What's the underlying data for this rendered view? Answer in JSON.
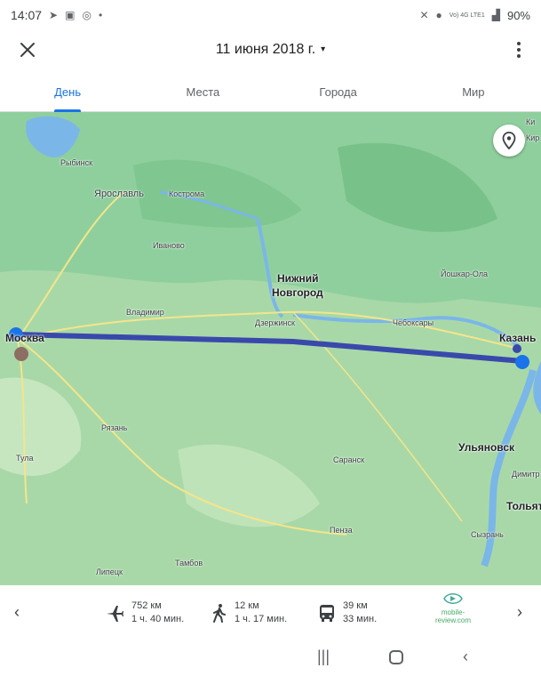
{
  "status": {
    "time": "14:07",
    "network": "Vo) 4G LTE1",
    "battery": "90%"
  },
  "appbar": {
    "date": "11 июня 2018 г.",
    "caret": "▾",
    "close_icon": "close-icon",
    "more_icon": "more-vert-icon"
  },
  "tabs": [
    {
      "label": "День",
      "active": true
    },
    {
      "label": "Места",
      "active": false
    },
    {
      "label": "Города",
      "active": false
    },
    {
      "label": "Мир",
      "active": false
    }
  ],
  "map": {
    "route_color": "#3949ab",
    "cities": {
      "rybinsk": "Рыбинск",
      "yaroslavl": "Ярославль",
      "kostroma": "Кострома",
      "ivanovo": "Иваново",
      "nizhny1": "Нижний",
      "nizhny2": "Новгород",
      "vladimir": "Владимир",
      "dzerzhinsk": "Дзержинск",
      "cheboksary": "Чебоксары",
      "yoshkar": "Йошкар-Ола",
      "kazan": "Казань",
      "moscow": "Москва",
      "ryazan": "Рязань",
      "tula": "Тула",
      "saransk": "Саранск",
      "ulyanovsk": "Ульяновск",
      "dimitrovgrad": "Димитр",
      "tolyatti": "Тольят",
      "penza": "Пенза",
      "syzran": "Сызрань",
      "tambov": "Тамбов",
      "lipetsk": "Липецк",
      "edge1": "Ки",
      "edge2": "Кир"
    }
  },
  "summary": {
    "flight": {
      "icon": "airplane-icon",
      "distance": "752 км",
      "duration": "1 ч. 40 мин."
    },
    "walk": {
      "icon": "walking-icon",
      "distance": "12 км",
      "duration": "1 ч. 17 мин."
    },
    "transit": {
      "icon": "bus-icon",
      "distance": "39 км",
      "duration": "33 мин."
    }
  },
  "watermark": "mobile-review.com"
}
